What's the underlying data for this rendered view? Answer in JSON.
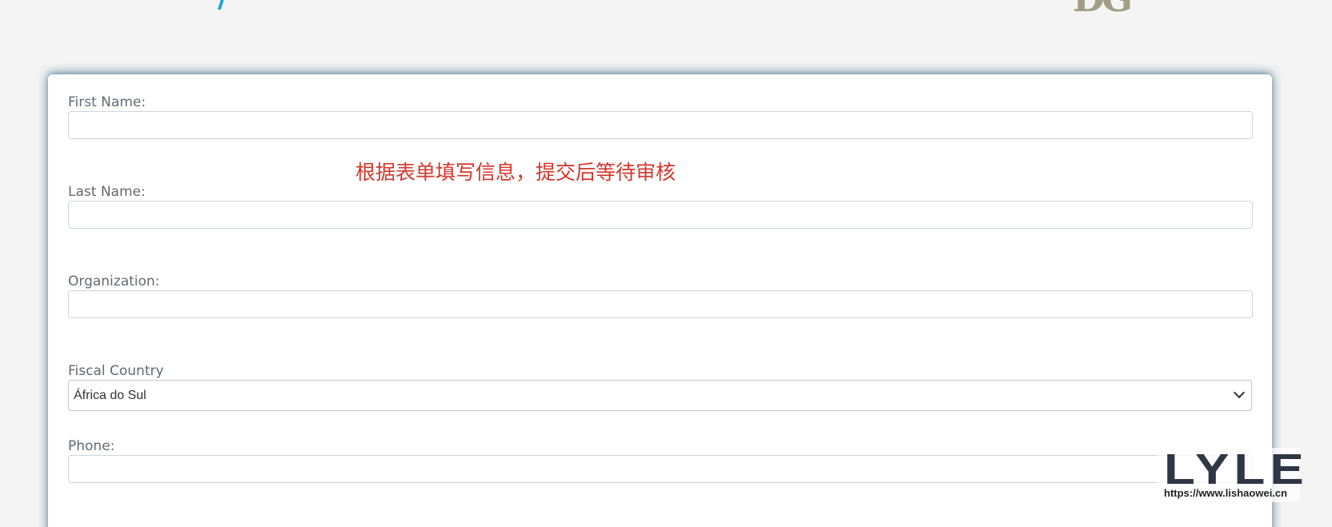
{
  "form": {
    "first_name_label": "First Name:",
    "first_name_value": "",
    "last_name_label": "Last Name:",
    "last_name_value": "",
    "organization_label": "Organization:",
    "organization_value": "",
    "fiscal_country_label": "Fiscal Country",
    "fiscal_country_value": "África do Sul",
    "phone_label": "Phone:",
    "phone_value": ""
  },
  "notice": {
    "text": "根据表单填写信息，提交后等待审核"
  },
  "watermark": {
    "brand": "LYLE",
    "url": "https://www.lishaowei.cn"
  },
  "colors": {
    "background": "#f4f4f4",
    "card": "#ffffff",
    "notice": "#d3372c",
    "label": "#606b72",
    "accent": "#18a7df"
  }
}
